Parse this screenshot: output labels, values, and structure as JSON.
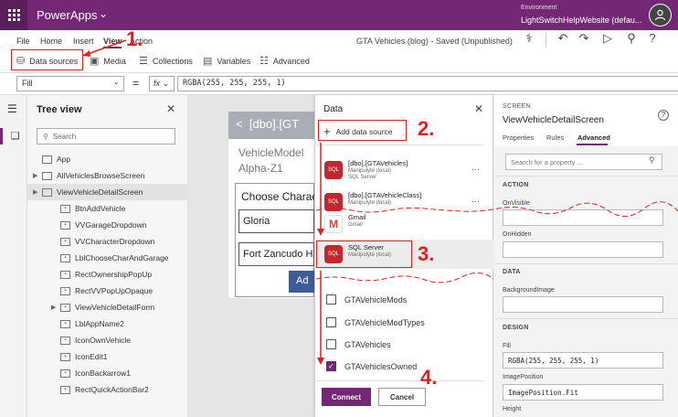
{
  "titlebar": {
    "app_title": "PowerApps",
    "env_label": "Environment",
    "env_name": "LightSwitchHelpWebsite (defau..."
  },
  "menu": {
    "items": [
      "File",
      "Home",
      "Insert",
      "View",
      "Action"
    ],
    "status": "GTA Vehicles (blog) - Saved (Unpublished)"
  },
  "ribbon": {
    "data_sources": "Data sources",
    "media": "Media",
    "collections": "Collections",
    "variables": "Variables",
    "advanced": "Advanced"
  },
  "formula": {
    "property": "Fill",
    "fx": "fx",
    "value": "RGBA(255, 255, 255, 1)"
  },
  "tree": {
    "title": "Tree view",
    "search_placeholder": "Search",
    "items": [
      {
        "label": "App",
        "indent": 0,
        "caret": false,
        "icon": "app",
        "selected": false
      },
      {
        "label": "AllVehiclesBrowseScreen",
        "indent": 0,
        "caret": true,
        "icon": "screen",
        "selected": false
      },
      {
        "label": "ViewVehicleDetailScreen",
        "indent": 0,
        "caret": true,
        "icon": "screen",
        "selected": true
      },
      {
        "label": "BtnAddVehicle",
        "indent": 1,
        "caret": false,
        "icon": "control",
        "selected": false
      },
      {
        "label": "VVGarageDropdown",
        "indent": 1,
        "caret": false,
        "icon": "control",
        "selected": false
      },
      {
        "label": "VVCharacterDropdown",
        "indent": 1,
        "caret": false,
        "icon": "control",
        "selected": false
      },
      {
        "label": "LblChooseCharAndGarage",
        "indent": 1,
        "caret": false,
        "icon": "control",
        "selected": false
      },
      {
        "label": "RectOwnershipPopUp",
        "indent": 1,
        "caret": false,
        "icon": "control",
        "selected": false
      },
      {
        "label": "RectVVPopUpOpaque",
        "indent": 1,
        "caret": false,
        "icon": "control",
        "selected": false
      },
      {
        "label": "ViewVehicleDetailForm",
        "indent": 1,
        "caret": true,
        "icon": "control",
        "selected": false
      },
      {
        "label": "LblAppName2",
        "indent": 1,
        "caret": false,
        "icon": "control",
        "selected": false
      },
      {
        "label": "IconOwnVehicle",
        "indent": 1,
        "caret": false,
        "icon": "control",
        "selected": false
      },
      {
        "label": "IconEdit1",
        "indent": 1,
        "caret": false,
        "icon": "control",
        "selected": false
      },
      {
        "label": "IconBackarrow1",
        "indent": 1,
        "caret": false,
        "icon": "control",
        "selected": false
      },
      {
        "label": "RectQuickActionBar2",
        "indent": 1,
        "caret": false,
        "icon": "control",
        "selected": false
      }
    ]
  },
  "preview": {
    "header": "[dbo].[GT",
    "back_arrow": "<",
    "model_label": "VehicleModel",
    "model_value": "Alpha-Z1",
    "choose": "Choose Characte",
    "gloria": "Gloria",
    "fort": "Fort Zancudo Ha",
    "add": "Ad"
  },
  "data_panel": {
    "title": "Data",
    "add_label": "Add data source",
    "sources": [
      {
        "name": "[dbo].[GTAVehicles]",
        "sub1": "Manipulyte (local)",
        "sub2": "SQL Server",
        "icon": "SQL"
      },
      {
        "name": "[dbo].[GTAVehicleClass]",
        "sub1": "Manipulyte (local)",
        "sub2": "",
        "icon": "SQL"
      },
      {
        "name": "Gmail",
        "sub1": "Gmail",
        "sub2": "",
        "icon": "M"
      },
      {
        "name": "SQL Server",
        "sub1": "Manipulyte (local)",
        "sub2": "",
        "icon": "SQL"
      }
    ],
    "tables": [
      {
        "name": "GTAVehicleMods",
        "checked": false
      },
      {
        "name": "GTAVehicleModTypes",
        "checked": false
      },
      {
        "name": "GTAVehicles",
        "checked": false
      },
      {
        "name": "GTAVehiclesOwned",
        "checked": true
      }
    ],
    "connect": "Connect",
    "cancel": "Cancel"
  },
  "props": {
    "kind": "SCREEN",
    "screen_name": "ViewVehicleDetailScreen",
    "tabs": [
      "Properties",
      "Rules",
      "Advanced"
    ],
    "search_placeholder": "Search for a property ...",
    "action_title": "ACTION",
    "on_visible": "OnVisible",
    "on_hidden": "OnHidden",
    "data_title": "DATA",
    "background_image": "BackgroundImage",
    "design_title": "DESIGN",
    "fill_label": "Fill",
    "fill_value": "RGBA(255, 255, 255, 1)",
    "image_position_label": "ImagePosition",
    "image_position_value": "ImagePosition.Fit",
    "height_label": "Height"
  },
  "annotations": [
    "1.",
    "2.",
    "3.",
    "4."
  ],
  "colors": {
    "accent": "#742774",
    "annotation": "#e02020",
    "sql_icon": "#c4262e"
  }
}
